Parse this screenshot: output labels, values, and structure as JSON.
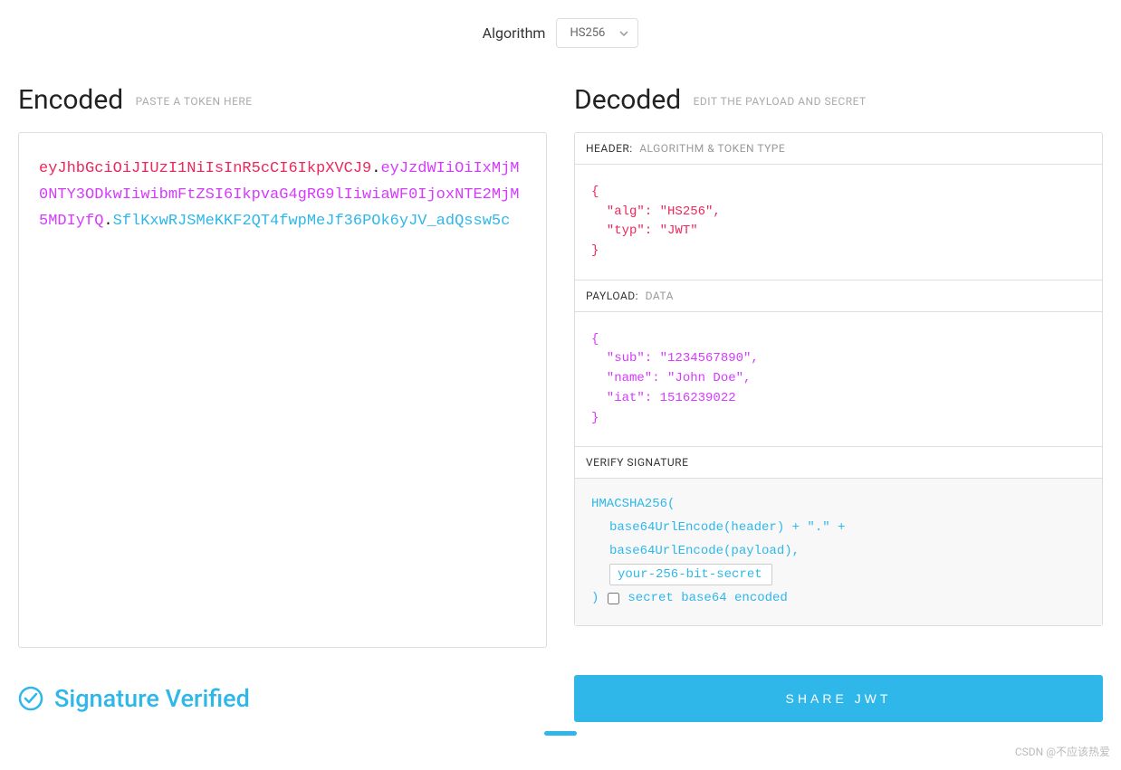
{
  "algorithm": {
    "label": "Algorithm",
    "selected": "HS256"
  },
  "encoded": {
    "title": "Encoded",
    "subtitle": "PASTE A TOKEN HERE",
    "header": "eyJhbGciOiJIUzI1NiIsInR5cCI6IkpXVCJ9",
    "payload": "eyJzdWIiOiIxMjM0NTY3ODkwIiwibmFtZSI6IkpvaG4gRG9lIiwiaWF0IjoxNTE2MjM5MDIyfQ",
    "signature": "SflKxwRJSMeKKF2QT4fwpMeJf36POk6yJV_adQssw5c"
  },
  "decoded": {
    "title": "Decoded",
    "subtitle": "EDIT THE PAYLOAD AND SECRET",
    "header_section": {
      "label": "HEADER:",
      "sublabel": "ALGORITHM & TOKEN TYPE",
      "content": "{\n  \"alg\": \"HS256\",\n  \"typ\": \"JWT\"\n}"
    },
    "payload_section": {
      "label": "PAYLOAD:",
      "sublabel": "DATA",
      "content": "{\n  \"sub\": \"1234567890\",\n  \"name\": \"John Doe\",\n  \"iat\": 1516239022\n}"
    },
    "signature_section": {
      "label": "VERIFY SIGNATURE",
      "line1": "HMACSHA256(",
      "line2": "base64UrlEncode(header) + \".\" +",
      "line3": "base64UrlEncode(payload),",
      "secret_value": "your-256-bit-secret",
      "line5_prefix": ")",
      "checkbox_label": "secret base64 encoded"
    }
  },
  "verified_text": "Signature Verified",
  "share_button": "SHARE JWT",
  "watermark": "CSDN @不应该热爱"
}
